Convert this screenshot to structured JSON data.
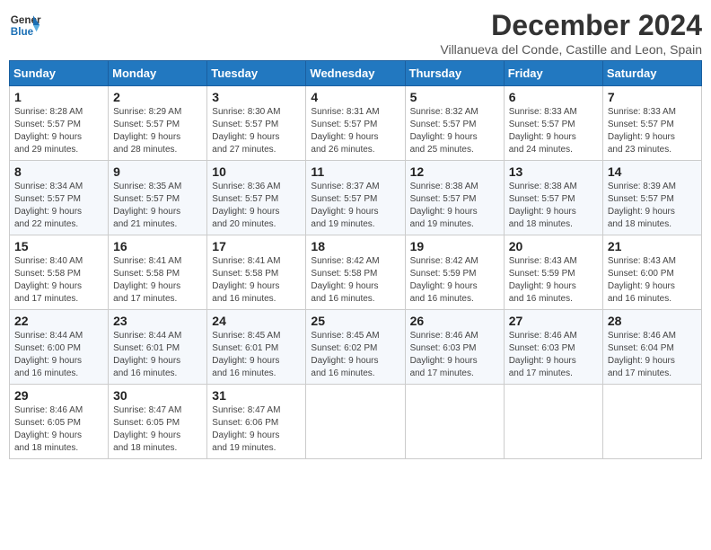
{
  "header": {
    "logo_line1": "General",
    "logo_line2": "Blue",
    "month_title": "December 2024",
    "location": "Villanueva del Conde, Castille and Leon, Spain"
  },
  "weekdays": [
    "Sunday",
    "Monday",
    "Tuesday",
    "Wednesday",
    "Thursday",
    "Friday",
    "Saturday"
  ],
  "weeks": [
    [
      {
        "day": "1",
        "info": "Sunrise: 8:28 AM\nSunset: 5:57 PM\nDaylight: 9 hours\nand 29 minutes."
      },
      {
        "day": "2",
        "info": "Sunrise: 8:29 AM\nSunset: 5:57 PM\nDaylight: 9 hours\nand 28 minutes."
      },
      {
        "day": "3",
        "info": "Sunrise: 8:30 AM\nSunset: 5:57 PM\nDaylight: 9 hours\nand 27 minutes."
      },
      {
        "day": "4",
        "info": "Sunrise: 8:31 AM\nSunset: 5:57 PM\nDaylight: 9 hours\nand 26 minutes."
      },
      {
        "day": "5",
        "info": "Sunrise: 8:32 AM\nSunset: 5:57 PM\nDaylight: 9 hours\nand 25 minutes."
      },
      {
        "day": "6",
        "info": "Sunrise: 8:33 AM\nSunset: 5:57 PM\nDaylight: 9 hours\nand 24 minutes."
      },
      {
        "day": "7",
        "info": "Sunrise: 8:33 AM\nSunset: 5:57 PM\nDaylight: 9 hours\nand 23 minutes."
      }
    ],
    [
      {
        "day": "8",
        "info": "Sunrise: 8:34 AM\nSunset: 5:57 PM\nDaylight: 9 hours\nand 22 minutes."
      },
      {
        "day": "9",
        "info": "Sunrise: 8:35 AM\nSunset: 5:57 PM\nDaylight: 9 hours\nand 21 minutes."
      },
      {
        "day": "10",
        "info": "Sunrise: 8:36 AM\nSunset: 5:57 PM\nDaylight: 9 hours\nand 20 minutes."
      },
      {
        "day": "11",
        "info": "Sunrise: 8:37 AM\nSunset: 5:57 PM\nDaylight: 9 hours\nand 19 minutes."
      },
      {
        "day": "12",
        "info": "Sunrise: 8:38 AM\nSunset: 5:57 PM\nDaylight: 9 hours\nand 19 minutes."
      },
      {
        "day": "13",
        "info": "Sunrise: 8:38 AM\nSunset: 5:57 PM\nDaylight: 9 hours\nand 18 minutes."
      },
      {
        "day": "14",
        "info": "Sunrise: 8:39 AM\nSunset: 5:57 PM\nDaylight: 9 hours\nand 18 minutes."
      }
    ],
    [
      {
        "day": "15",
        "info": "Sunrise: 8:40 AM\nSunset: 5:58 PM\nDaylight: 9 hours\nand 17 minutes."
      },
      {
        "day": "16",
        "info": "Sunrise: 8:41 AM\nSunset: 5:58 PM\nDaylight: 9 hours\nand 17 minutes."
      },
      {
        "day": "17",
        "info": "Sunrise: 8:41 AM\nSunset: 5:58 PM\nDaylight: 9 hours\nand 16 minutes."
      },
      {
        "day": "18",
        "info": "Sunrise: 8:42 AM\nSunset: 5:58 PM\nDaylight: 9 hours\nand 16 minutes."
      },
      {
        "day": "19",
        "info": "Sunrise: 8:42 AM\nSunset: 5:59 PM\nDaylight: 9 hours\nand 16 minutes."
      },
      {
        "day": "20",
        "info": "Sunrise: 8:43 AM\nSunset: 5:59 PM\nDaylight: 9 hours\nand 16 minutes."
      },
      {
        "day": "21",
        "info": "Sunrise: 8:43 AM\nSunset: 6:00 PM\nDaylight: 9 hours\nand 16 minutes."
      }
    ],
    [
      {
        "day": "22",
        "info": "Sunrise: 8:44 AM\nSunset: 6:00 PM\nDaylight: 9 hours\nand 16 minutes."
      },
      {
        "day": "23",
        "info": "Sunrise: 8:44 AM\nSunset: 6:01 PM\nDaylight: 9 hours\nand 16 minutes."
      },
      {
        "day": "24",
        "info": "Sunrise: 8:45 AM\nSunset: 6:01 PM\nDaylight: 9 hours\nand 16 minutes."
      },
      {
        "day": "25",
        "info": "Sunrise: 8:45 AM\nSunset: 6:02 PM\nDaylight: 9 hours\nand 16 minutes."
      },
      {
        "day": "26",
        "info": "Sunrise: 8:46 AM\nSunset: 6:03 PM\nDaylight: 9 hours\nand 17 minutes."
      },
      {
        "day": "27",
        "info": "Sunrise: 8:46 AM\nSunset: 6:03 PM\nDaylight: 9 hours\nand 17 minutes."
      },
      {
        "day": "28",
        "info": "Sunrise: 8:46 AM\nSunset: 6:04 PM\nDaylight: 9 hours\nand 17 minutes."
      }
    ],
    [
      {
        "day": "29",
        "info": "Sunrise: 8:46 AM\nSunset: 6:05 PM\nDaylight: 9 hours\nand 18 minutes."
      },
      {
        "day": "30",
        "info": "Sunrise: 8:47 AM\nSunset: 6:05 PM\nDaylight: 9 hours\nand 18 minutes."
      },
      {
        "day": "31",
        "info": "Sunrise: 8:47 AM\nSunset: 6:06 PM\nDaylight: 9 hours\nand 19 minutes."
      },
      {
        "day": "",
        "info": ""
      },
      {
        "day": "",
        "info": ""
      },
      {
        "day": "",
        "info": ""
      },
      {
        "day": "",
        "info": ""
      }
    ]
  ]
}
